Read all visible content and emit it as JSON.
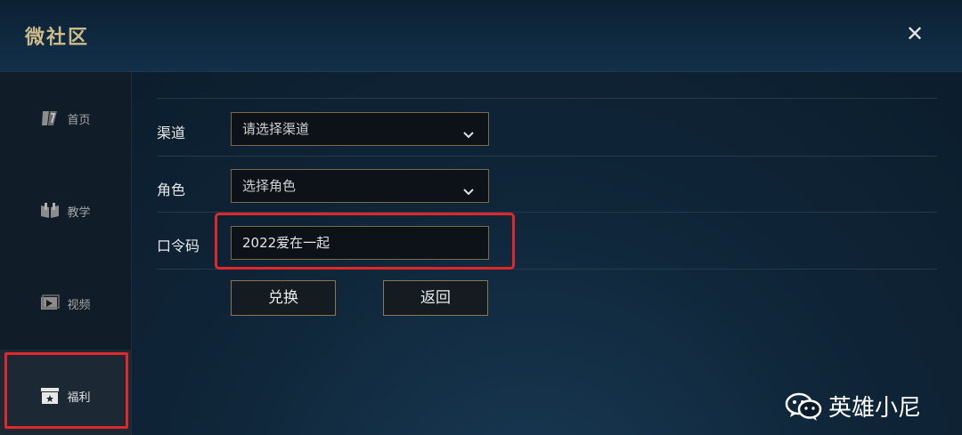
{
  "window": {
    "title": "微社区",
    "close_icon": "close-icon"
  },
  "sidebar": {
    "items": [
      {
        "label": "首页",
        "icon": "home-icon"
      },
      {
        "label": "教学",
        "icon": "book-icon"
      },
      {
        "label": "视频",
        "icon": "video-icon"
      },
      {
        "label": "福利",
        "icon": "gift-icon",
        "active": true
      }
    ]
  },
  "form": {
    "channel": {
      "label": "渠道",
      "value": "请选择渠道"
    },
    "role": {
      "label": "角色",
      "value": "选择角色"
    },
    "code": {
      "label": "口令码",
      "value": "2022爱在一起"
    },
    "redeem_label": "兑换",
    "back_label": "返回"
  },
  "watermark": {
    "text": "英雄小尼",
    "icon": "wechat-icon"
  },
  "colors": {
    "accent_gold": "#7b6a45",
    "highlight_red": "#e0282a",
    "title_gold": "#cdbb8a"
  }
}
